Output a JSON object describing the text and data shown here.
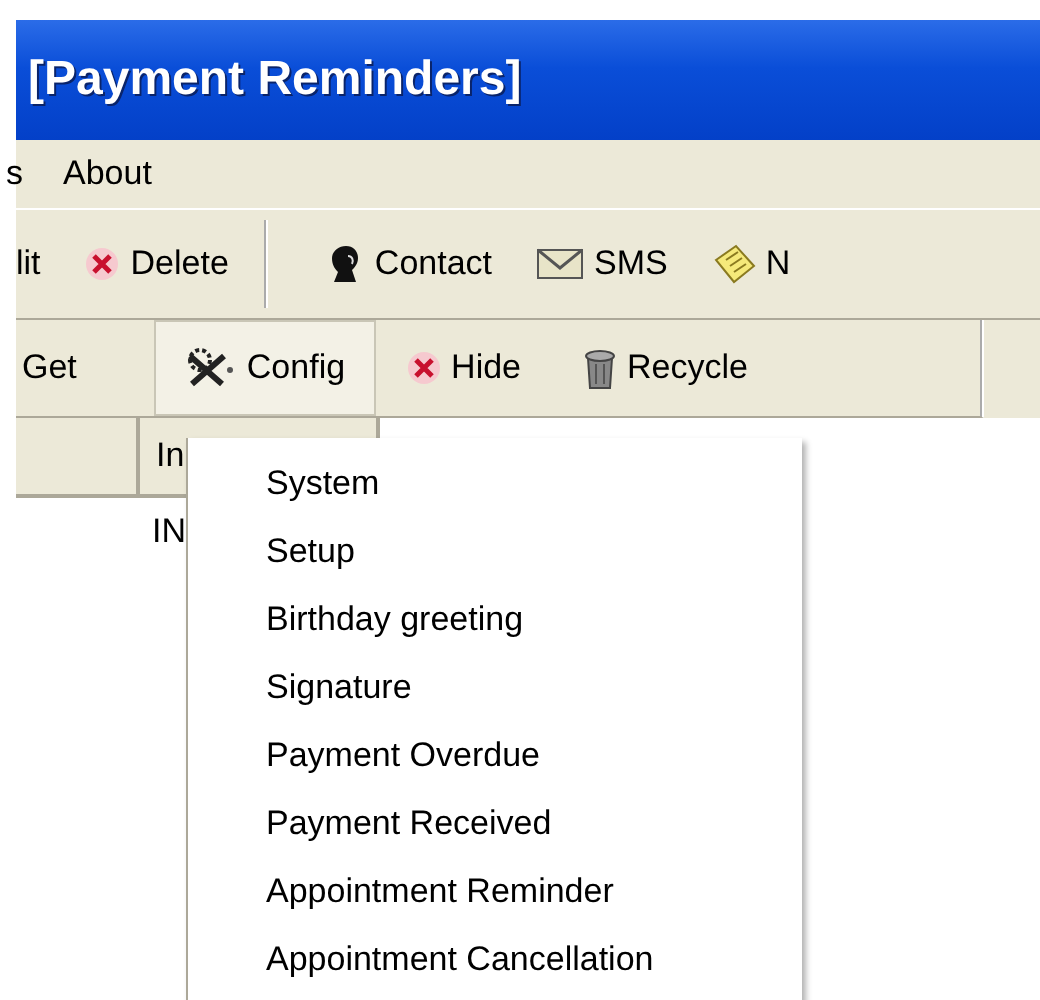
{
  "window": {
    "title": "[Payment Reminders]"
  },
  "menu_bar": [
    "s",
    "About"
  ],
  "toolbar_1": {
    "groups": [
      [
        {
          "label": "lit",
          "kind": "plain"
        },
        {
          "label": "Delete",
          "kind": "delete"
        }
      ],
      [
        {
          "label": "Contact",
          "kind": "contact"
        },
        {
          "label": "SMS",
          "kind": "mail"
        },
        {
          "label": "N",
          "kind": "note"
        }
      ]
    ]
  },
  "toolbar_2": {
    "items": [
      {
        "label": "Get",
        "kind": "plain",
        "selected": false
      },
      {
        "label": "Config",
        "kind": "tools",
        "selected": true
      },
      {
        "label": "Hide",
        "kind": "delete",
        "selected": false
      },
      {
        "label": "Recycle",
        "kind": "bin",
        "selected": false
      }
    ]
  },
  "list": {
    "columns": [
      "In"
    ],
    "rows": [
      [
        "IN"
      ]
    ]
  },
  "dropdown_menu": {
    "items": [
      "System",
      "Setup",
      "Birthday greeting",
      "Signature",
      "Payment Overdue",
      "Payment Received",
      "Appointment Reminder",
      "Appointment Cancellation"
    ]
  }
}
